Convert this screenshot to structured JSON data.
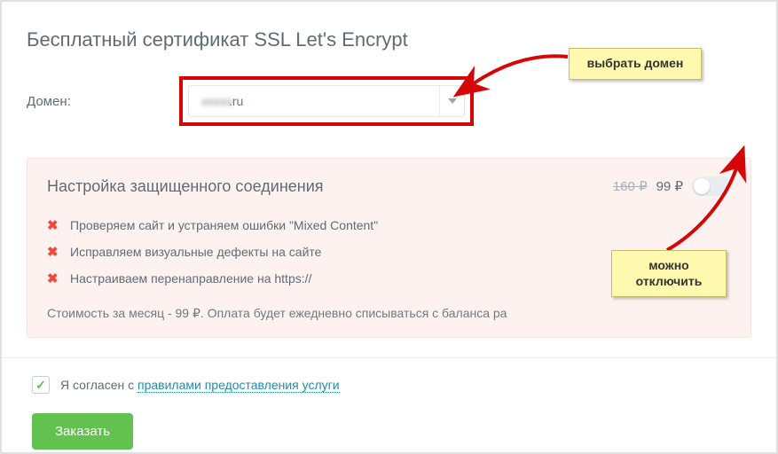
{
  "title": "Бесплатный сертификат SSL Let's Encrypt",
  "domain": {
    "label": "Домен:",
    "value_blurred": "xxxxx",
    "suffix": ".ru"
  },
  "panel": {
    "title": "Настройка защищенного соединения",
    "old_price": "160 ₽",
    "new_price": "99 ₽",
    "features": [
      "Проверяем сайт и устраняем ошибки \"Mixed Content\"",
      "Исправляем визуальные дефекты на сайте",
      "Настраиваем перенаправление на https://"
    ],
    "cost_line": "Стоимость за месяц - 99 ₽. Оплата будет ежедневно списываться с баланса ра"
  },
  "agreement": {
    "prefix": "Я согласен с ",
    "link_text": "правилами предоставления услуги"
  },
  "order_button": "Заказать",
  "callouts": {
    "select_domain": "выбрать домен",
    "can_disable": "можно отключить"
  }
}
